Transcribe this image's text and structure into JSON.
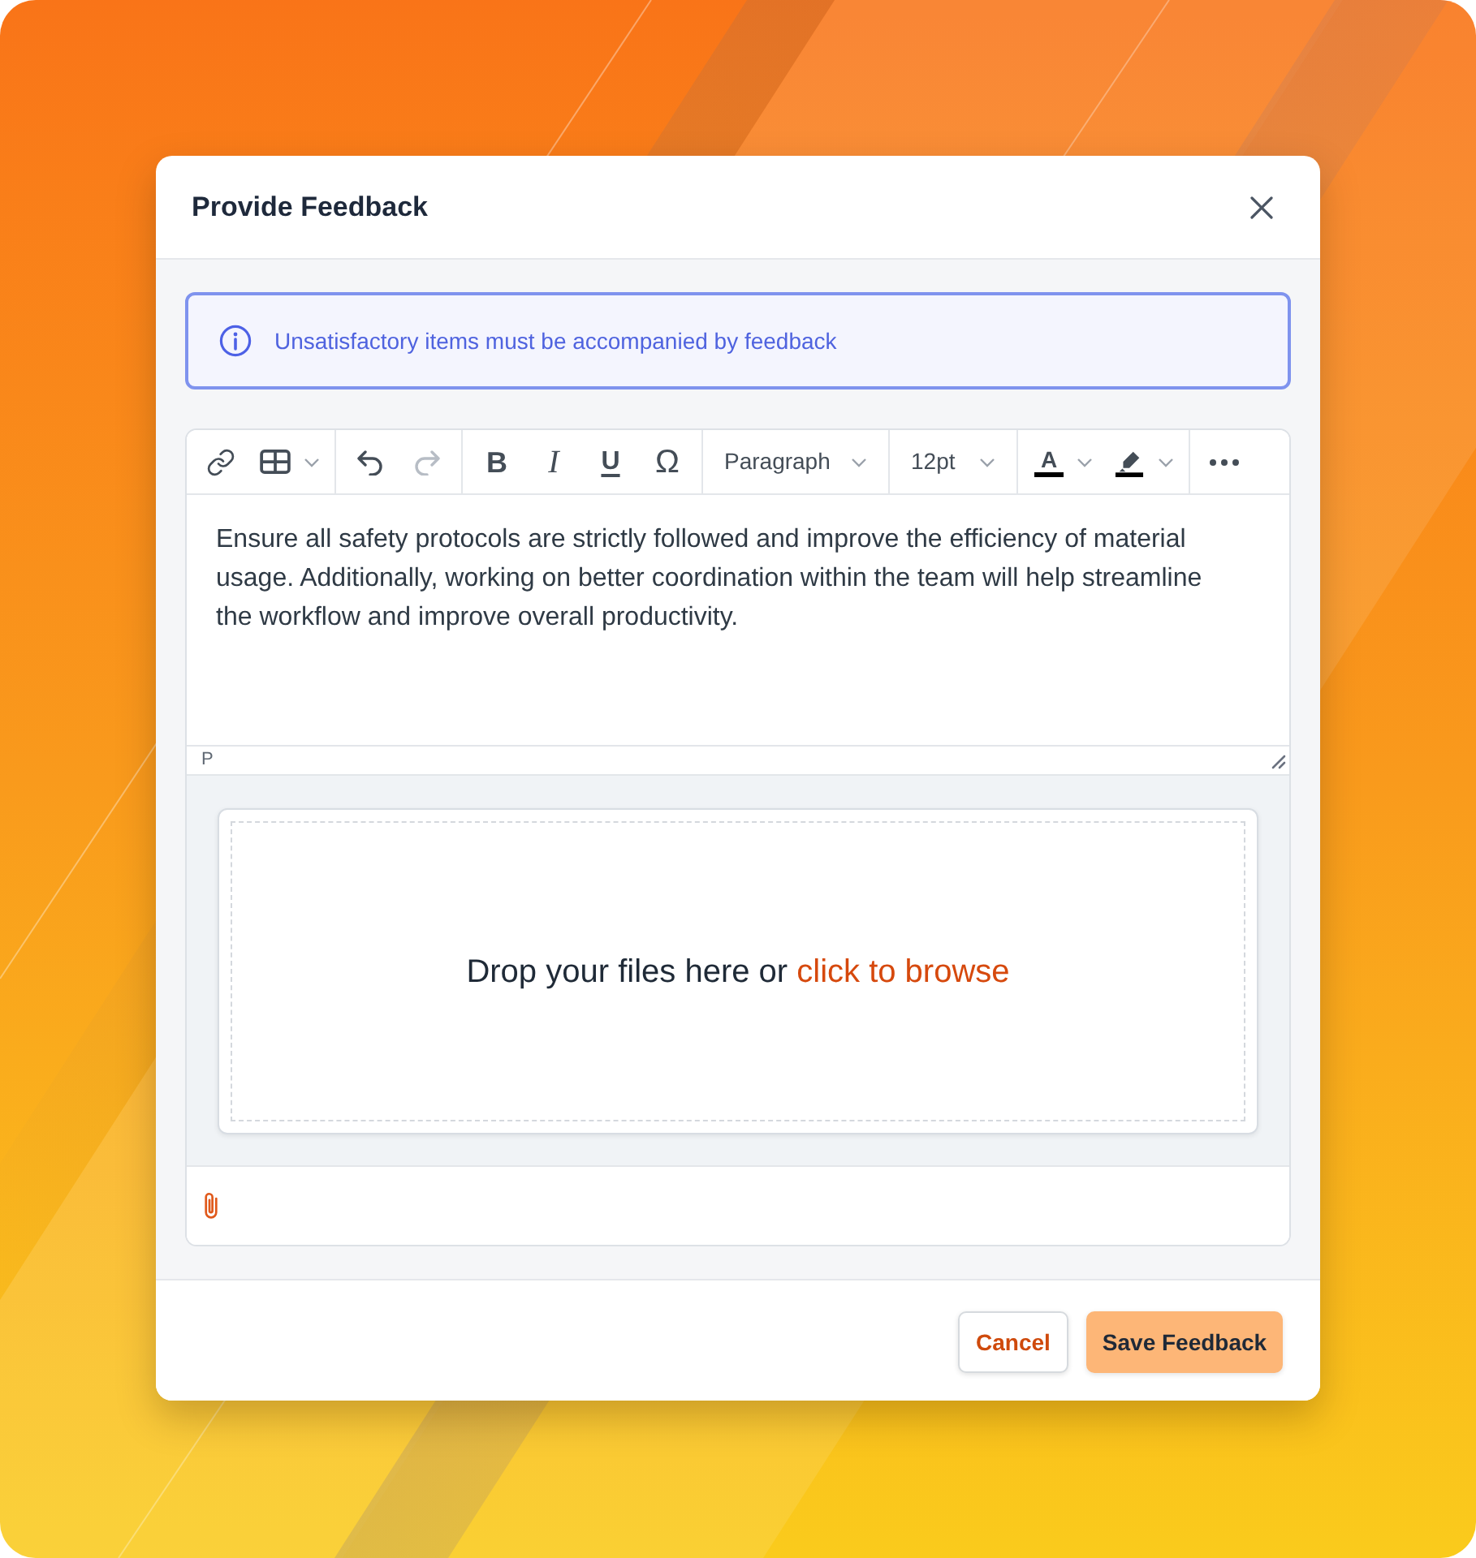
{
  "dialog": {
    "title": "Provide Feedback"
  },
  "notice": {
    "text": "Unsatisfactory items must be accompanied by feedback"
  },
  "editor": {
    "toolbar": [
      {
        "items": [
          {
            "kind": "button",
            "disabled": false
          },
          {
            "kind": "split",
            "disabled": false
          }
        ]
      },
      {
        "items": [
          {
            "kind": "button",
            "disabled": false
          },
          {
            "kind": "button",
            "disabled": true
          }
        ]
      },
      {
        "items": [
          {
            "kind": "glyph",
            "glyph": "B",
            "disabled": false
          },
          {
            "kind": "glyph",
            "glyph": "I",
            "disabled": false
          },
          {
            "kind": "glyph",
            "glyph": "U",
            "disabled": false
          },
          {
            "kind": "glyph",
            "glyph": "Ω",
            "disabled": false
          }
        ]
      },
      {
        "items": [
          {
            "kind": "select",
            "value": "Paragraph",
            "disabled": false
          }
        ]
      },
      {
        "items": [
          {
            "kind": "select",
            "value": "12pt",
            "disabled": false
          }
        ]
      },
      {
        "items": [
          {
            "kind": "split",
            "glyph": "A",
            "disabled": false
          },
          {
            "kind": "split",
            "disabled": false
          }
        ]
      },
      {
        "items": [
          {
            "kind": "button",
            "disabled": false
          }
        ]
      }
    ],
    "content": "Ensure all safety protocols are strictly followed and improve the efficiency of material usage. Additionally, working on better coordination within the team will help streamline the workflow and improve overall productivity.",
    "element_path": "P"
  },
  "upload": {
    "prompt": "Drop your files here or",
    "link": "click to browse"
  },
  "buttons": [
    {
      "label": "Cancel",
      "kind": "secondary"
    },
    {
      "label": "Save Feedback",
      "kind": "primary"
    }
  ]
}
